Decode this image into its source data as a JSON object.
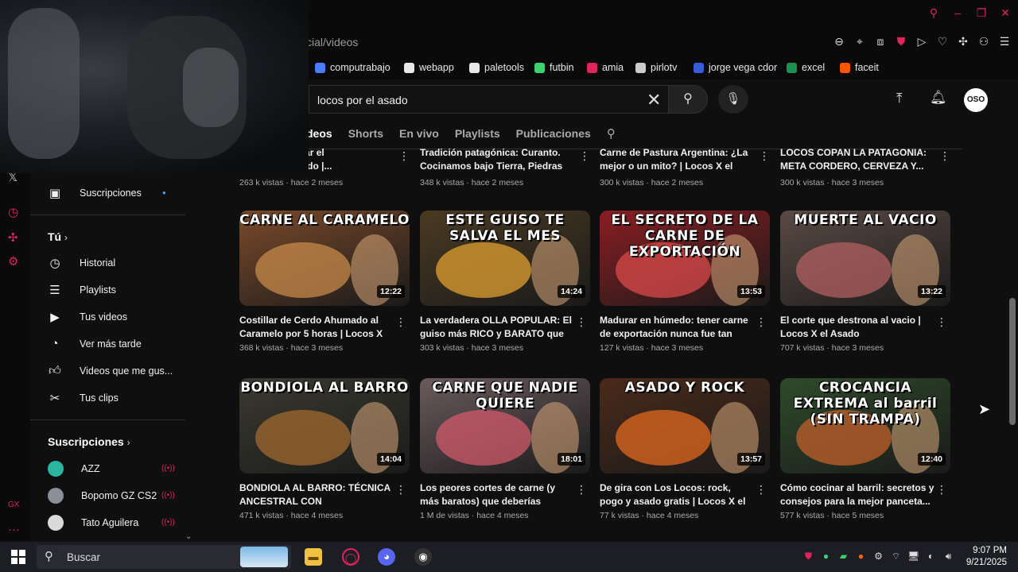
{
  "browser": {
    "address": "cial/videos"
  },
  "bookmarks": [
    {
      "label": "computrabajo",
      "color": "#4a7cff"
    },
    {
      "label": "webapp",
      "color": "#e8e8e8"
    },
    {
      "label": "paletools",
      "color": "#e8e8e8"
    },
    {
      "label": "futbin",
      "color": "#3ecf6e"
    },
    {
      "label": "amia",
      "color": "#e0245e"
    },
    {
      "label": "pirlotv",
      "color": "#cccccc"
    },
    {
      "label": "jorge vega cdor",
      "color": "#3a5bd9"
    },
    {
      "label": "excel",
      "color": "#1d8f4e"
    },
    {
      "label": "faceit",
      "color": "#ff5500"
    }
  ],
  "header": {
    "search_value": "locos por el asado",
    "avatar_text": "OSO"
  },
  "tabs": [
    {
      "label": "deos",
      "active": true
    },
    {
      "label": "Shorts",
      "active": false
    },
    {
      "label": "En vivo",
      "active": false
    },
    {
      "label": "Playlists",
      "active": false
    },
    {
      "label": "Publicaciones",
      "active": false
    }
  ],
  "sidebar": {
    "subscriptions_top": "Suscripciones",
    "you_heading": "Tú",
    "items": [
      {
        "label": "Historial"
      },
      {
        "label": "Playlists"
      },
      {
        "label": "Tus videos"
      },
      {
        "label": "Ver más tarde"
      },
      {
        "label": "Videos que me gus..."
      },
      {
        "label": "Tus clips"
      }
    ],
    "subs_heading": "Suscripciones",
    "subs": [
      {
        "label": "AZZ",
        "color": "#2bb5a0"
      },
      {
        "label": "Bopomo GZ CS2",
        "color": "#8a8f99"
      },
      {
        "label": "Tato Aguilera",
        "color": "#d9d9d9"
      }
    ]
  },
  "top_row": [
    {
      "title_l1": "ativa para lograr el",
      "title_l2": "Tierno del Mundo |...",
      "meta": "263 k vistas · hace 2 meses"
    },
    {
      "title_l1": "Tradición patagónica: Curanto.",
      "title_l2": "Cocinamos bajo Tierra, Piedras y...",
      "meta": "348 k vistas · hace 2 meses"
    },
    {
      "title_l1": "Carne de Pastura Argentina: ¿La",
      "title_l2": "mejor o un mito? | Locos X el Asado",
      "meta": "300 k vistas · hace 2 meses"
    },
    {
      "title_l1": "LOCOS COPAN LA PATAGONIA:",
      "title_l2": "META CORDERO, CERVEZA Y...",
      "meta": "300 k vistas · hace 3 meses"
    }
  ],
  "videos": [
    {
      "thumb_text": "CARNE AL CARAMELO",
      "duration": "12:22",
      "title": "Costillar de Cerdo Ahumado al Caramelo por 5 horas | Locos X el...",
      "meta": "368 k vistas · hace 3 meses",
      "bg": "#7a4a2a",
      "accent": "#c58a4a"
    },
    {
      "thumb_text": "ESTE GUISO TE SALVA EL MES",
      "duration": "14:24",
      "title": "La verdadera OLLA POPULAR: El guiso más RICO y BARATO que va...",
      "meta": "303 k vistas · hace 3 meses",
      "bg": "#4a3a22",
      "accent": "#e0a030"
    },
    {
      "thumb_text": "EL SECRETO DE LA CARNE DE EXPORTACIÓN",
      "duration": "13:53",
      "title": "Madurar en húmedo: tener carne de exportación nunca fue tan fácil.. y...",
      "meta": "127 k vistas · hace 3 meses",
      "bg": "#8a1e22",
      "accent": "#d94a4a"
    },
    {
      "thumb_text": "MUERTE AL VACIO",
      "duration": "13:22",
      "title": "El corte que destrona al vacio | Locos X el Asado",
      "meta": "707 k vistas · hace 3 meses",
      "bg": "#5a4a44",
      "accent": "#b06060"
    },
    {
      "thumb_text": "BONDIOLA AL BARRO",
      "duration": "14:04",
      "title": "BONDIOLA AL BARRO: TÉCNICA ANCESTRAL CON RESULTADOS...",
      "meta": "471 k vistas · hace 4 meses",
      "bg": "#3a3a30",
      "accent": "#a06a30"
    },
    {
      "thumb_text": "CARNE QUE NADIE QUIERE",
      "duration": "18:01",
      "title": "Los peores cortes de carne (y más baratos) que deberías comprar |...",
      "meta": "1 M de vistas · hace 4 meses",
      "bg": "#6a5a5e",
      "accent": "#d05a6a"
    },
    {
      "thumb_text": "ASADO Y ROCK",
      "duration": "13:57",
      "title": "De gira con Los Locos: rock, pogo y asado gratis | Locos X el Asado",
      "meta": "77 k vistas · hace 4 meses",
      "bg": "#4a2a1a",
      "accent": "#e06a20"
    },
    {
      "thumb_text": "CROCANCIA EXTREMA al barril (SIN TRAMPA)",
      "duration": "12:40",
      "title": "Cómo cocinar al barril: secretos y consejos para la mejor panceta...",
      "meta": "577 k vistas · hace 5 meses",
      "bg": "#2e4a2a",
      "accent": "#c0602a"
    }
  ],
  "taskbar": {
    "search_text": "Buscar",
    "time": "9:07 PM",
    "date": "9/21/2025"
  },
  "colors": {
    "accent_red": "#e0245e",
    "bg": "#0f0f0f"
  }
}
